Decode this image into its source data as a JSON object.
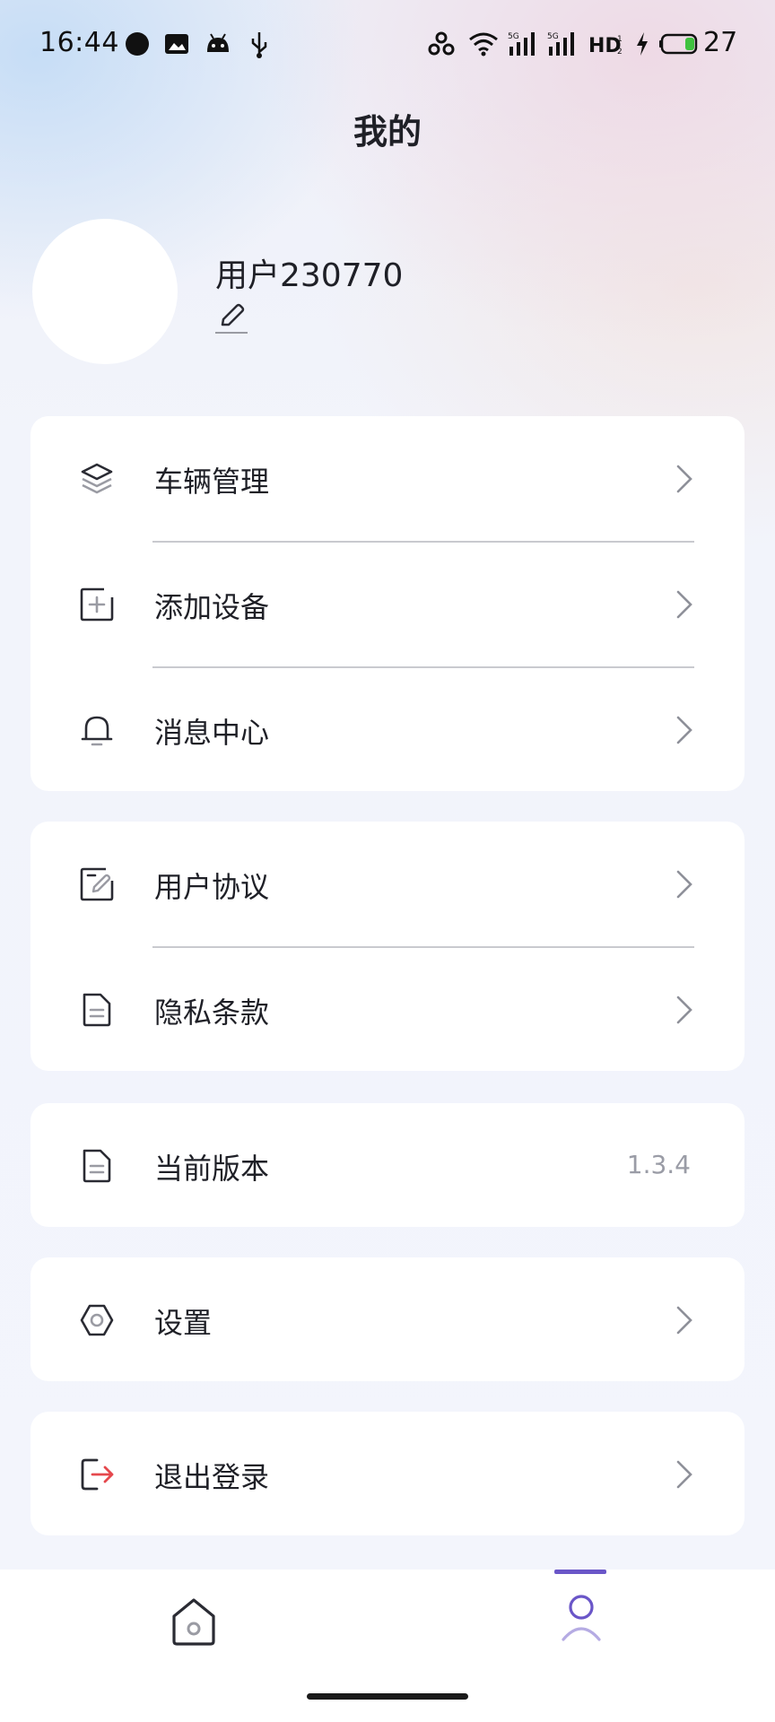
{
  "status_bar": {
    "time": "16:44",
    "battery": "27"
  },
  "header": {
    "title": "我的"
  },
  "profile": {
    "username": "用户230770"
  },
  "menu": {
    "group1": [
      {
        "label": "车辆管理",
        "icon": "layers-icon"
      },
      {
        "label": "添加设备",
        "icon": "add-square-icon"
      },
      {
        "label": "消息中心",
        "icon": "bell-icon"
      }
    ],
    "group2": [
      {
        "label": "用户协议",
        "icon": "edit-document-icon"
      },
      {
        "label": "隐私条款",
        "icon": "document-icon"
      }
    ],
    "version": {
      "label": "当前版本",
      "value": "1.3.4",
      "icon": "document-icon"
    },
    "settings": {
      "label": "设置",
      "icon": "hexagon-settings-icon"
    },
    "logout": {
      "label": "退出登录",
      "icon": "logout-icon"
    }
  },
  "bottom_nav": {
    "items": [
      {
        "name": "home",
        "icon": "home-icon",
        "active": false
      },
      {
        "name": "mine",
        "icon": "user-icon",
        "active": true
      }
    ]
  },
  "colors": {
    "accent": "#6a56c8",
    "logout_arrow": "#e5484d",
    "text": "#1f2027",
    "muted": "#9a9ca6"
  }
}
